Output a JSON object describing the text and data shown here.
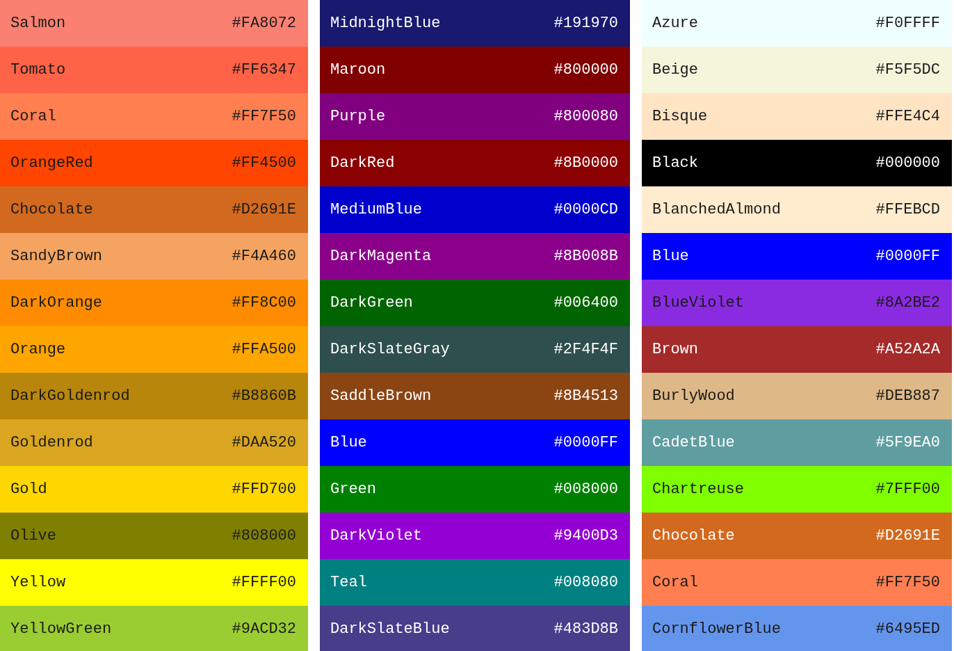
{
  "columns": [
    {
      "swatches": [
        {
          "name": "Salmon",
          "hex": "#FA8072",
          "color": "#fa8072",
          "kind": "dark"
        },
        {
          "name": "Tomato",
          "hex": "#FF6347",
          "color": "#ff6347",
          "kind": "dark"
        },
        {
          "name": "Coral",
          "hex": "#FF7F50",
          "color": "#ff7f50",
          "kind": "dark"
        },
        {
          "name": "OrangeRed",
          "hex": "#FF4500",
          "color": "#ff4500",
          "kind": "dark"
        },
        {
          "name": "Chocolate",
          "hex": "#D2691E",
          "color": "#d2691e",
          "kind": "dark"
        },
        {
          "name": "SandyBrown",
          "hex": "#F4A460",
          "color": "#f4a460",
          "kind": "dark"
        },
        {
          "name": "DarkOrange",
          "hex": "#FF8C00",
          "color": "#ff8c00",
          "kind": "dark"
        },
        {
          "name": "Orange",
          "hex": "#FFA500",
          "color": "#ffa500",
          "kind": "dark"
        },
        {
          "name": "DarkGoldenrod",
          "hex": "#B8860B",
          "color": "#b8860b",
          "kind": "dark"
        },
        {
          "name": "Goldenrod",
          "hex": "#DAA520",
          "color": "#daa520",
          "kind": "dark"
        },
        {
          "name": "Gold",
          "hex": "#FFD700",
          "color": "#ffd700",
          "kind": "dark"
        },
        {
          "name": "Olive",
          "hex": "#808000",
          "color": "#808000",
          "kind": "dark"
        },
        {
          "name": "Yellow",
          "hex": "#FFFF00",
          "color": "#ffff00",
          "kind": "dark"
        },
        {
          "name": "YellowGreen",
          "hex": "#9ACD32",
          "color": "#9acd32",
          "kind": "dark"
        }
      ]
    },
    {
      "swatches": [
        {
          "name": "MidnightBlue",
          "hex": "#191970",
          "color": "#191970",
          "kind": "light"
        },
        {
          "name": "Maroon",
          "hex": "#800000",
          "color": "#800000",
          "kind": "light"
        },
        {
          "name": "Purple",
          "hex": "#800080",
          "color": "#800080",
          "kind": "light"
        },
        {
          "name": "DarkRed",
          "hex": "#8B0000",
          "color": "#8b0000",
          "kind": "light"
        },
        {
          "name": "MediumBlue",
          "hex": "#0000CD",
          "color": "#0000cd",
          "kind": "light"
        },
        {
          "name": "DarkMagenta",
          "hex": "#8B008B",
          "color": "#8b008b",
          "kind": "light"
        },
        {
          "name": "DarkGreen",
          "hex": "#006400",
          "color": "#006400",
          "kind": "light"
        },
        {
          "name": "DarkSlateGray",
          "hex": "#2F4F4F",
          "color": "#2f4f4f",
          "kind": "light"
        },
        {
          "name": "SaddleBrown",
          "hex": "#8B4513",
          "color": "#8b4513",
          "kind": "light"
        },
        {
          "name": "Blue",
          "hex": "#0000FF",
          "color": "#0000ff",
          "kind": "light"
        },
        {
          "name": "Green",
          "hex": "#008000",
          "color": "#008000",
          "kind": "light"
        },
        {
          "name": "DarkViolet",
          "hex": "#9400D3",
          "color": "#9400d3",
          "kind": "light"
        },
        {
          "name": "Teal",
          "hex": "#008080",
          "color": "#008080",
          "kind": "light"
        },
        {
          "name": "DarkSlateBlue",
          "hex": "#483D8B",
          "color": "#483d8b",
          "kind": "light"
        }
      ]
    },
    {
      "swatches": [
        {
          "name": "Azure",
          "hex": "#F0FFFF",
          "color": "#f0ffff",
          "kind": "dark"
        },
        {
          "name": "Beige",
          "hex": "#F5F5DC",
          "color": "#f5f5dc",
          "kind": "dark"
        },
        {
          "name": "Bisque",
          "hex": "#FFE4C4",
          "color": "#ffe4c4",
          "kind": "dark"
        },
        {
          "name": "Black",
          "hex": "#000000",
          "color": "#000000",
          "kind": "light"
        },
        {
          "name": "BlanchedAlmond",
          "hex": "#FFEBCD",
          "color": "#ffebcd",
          "kind": "dark"
        },
        {
          "name": "Blue",
          "hex": "#0000FF",
          "color": "#0000ff",
          "kind": "light"
        },
        {
          "name": "BlueViolet",
          "hex": "#8A2BE2",
          "color": "#8a2be2",
          "kind": "dark"
        },
        {
          "name": "Brown",
          "hex": "#A52A2A",
          "color": "#a52a2a",
          "kind": "light"
        },
        {
          "name": "BurlyWood",
          "hex": "#DEB887",
          "color": "#deb887",
          "kind": "dark"
        },
        {
          "name": "CadetBlue",
          "hex": "#5F9EA0",
          "color": "#5f9ea0",
          "kind": "light"
        },
        {
          "name": "Chartreuse",
          "hex": "#7FFF00",
          "color": "#7fff00",
          "kind": "dark"
        },
        {
          "name": "Chocolate",
          "hex": "#D2691E",
          "color": "#d2691e",
          "kind": "light"
        },
        {
          "name": "Coral",
          "hex": "#FF7F50",
          "color": "#ff7f50",
          "kind": "dark"
        },
        {
          "name": "CornflowerBlue",
          "hex": "#6495ED",
          "color": "#6495ed",
          "kind": "dark"
        }
      ]
    }
  ]
}
